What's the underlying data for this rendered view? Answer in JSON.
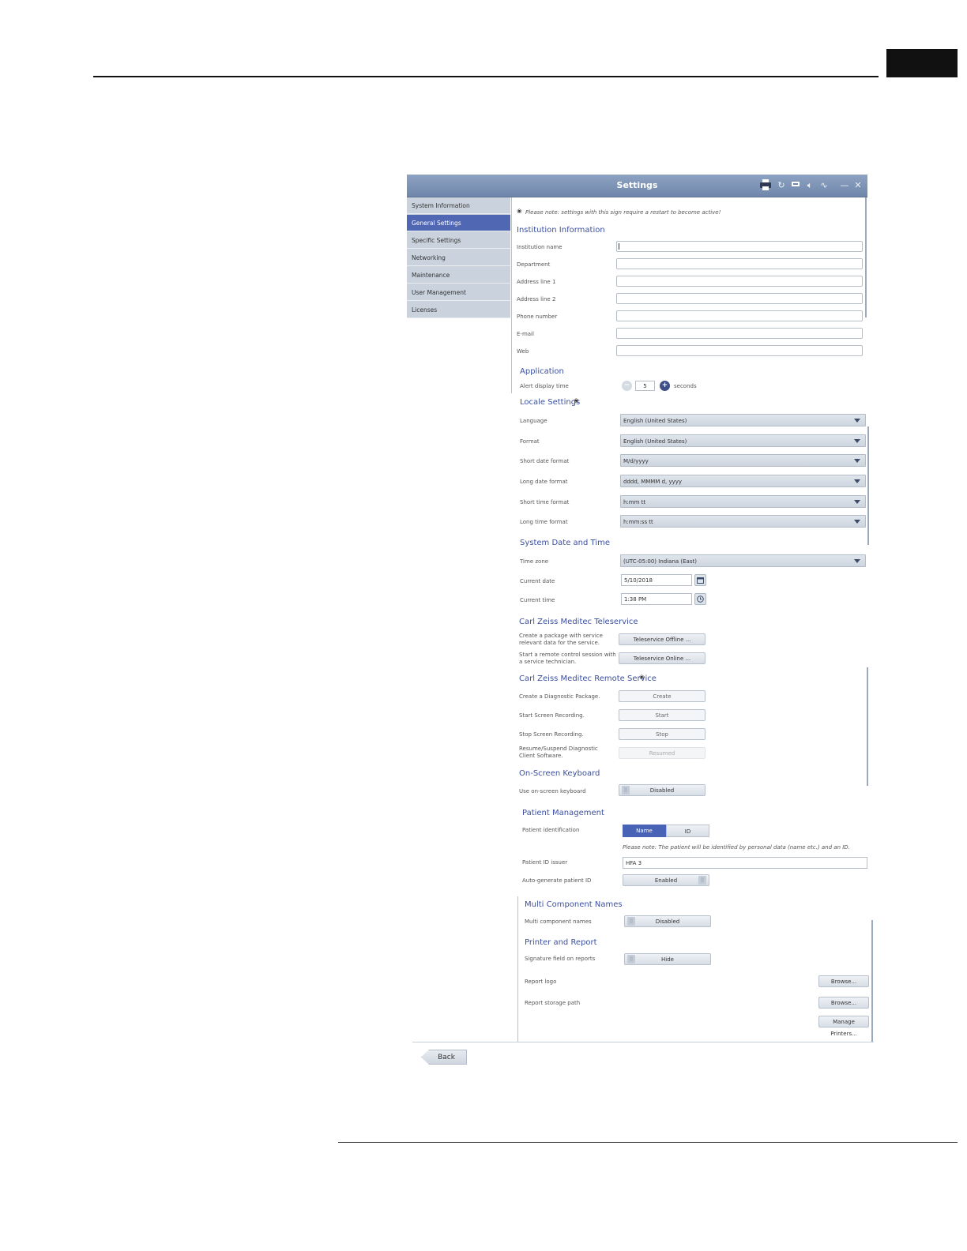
{
  "window": {
    "title": "Settings",
    "icons": [
      "printer-icon",
      "refresh-icon",
      "monitor-icon",
      "speaker-icon",
      "network-icon",
      "minimize-icon",
      "close-icon"
    ]
  },
  "sidebar": {
    "items": [
      {
        "label": "System Information",
        "active": false
      },
      {
        "label": "General Settings",
        "active": true
      },
      {
        "label": "Specific Settings",
        "active": false
      },
      {
        "label": "Networking",
        "active": false
      },
      {
        "label": "Maintenance",
        "active": false
      },
      {
        "label": "User Management",
        "active": false
      },
      {
        "label": "Licenses",
        "active": false
      }
    ]
  },
  "restart_note": "Please note: settings with this sign require a restart to become active!",
  "institution": {
    "heading": "Institution Information",
    "fields": [
      {
        "label": "Institution name",
        "value": ""
      },
      {
        "label": "Department",
        "value": ""
      },
      {
        "label": "Address line 1",
        "value": ""
      },
      {
        "label": "Address line 2",
        "value": ""
      },
      {
        "label": "Phone number",
        "value": ""
      },
      {
        "label": "E-mail",
        "value": ""
      },
      {
        "label": "Web",
        "value": ""
      }
    ]
  },
  "application": {
    "heading": "Application",
    "alert_label": "Alert display time",
    "alert_value": "5",
    "alert_unit": "seconds"
  },
  "locale": {
    "heading": "Locale Settings",
    "rows": [
      {
        "label": "Language",
        "value": "English (United States)"
      },
      {
        "label": "Format",
        "value": "English (United States)"
      },
      {
        "label": "Short date format",
        "value": "M/d/yyyy"
      },
      {
        "label": "Long date format",
        "value": "dddd, MMMM d, yyyy"
      },
      {
        "label": "Short time format",
        "value": "h:mm tt"
      },
      {
        "label": "Long time format",
        "value": "h:mm:ss tt"
      }
    ]
  },
  "datetime": {
    "heading": "System Date and Time",
    "timezone_label": "Time zone",
    "timezone_value": "(UTC-05:00) Indiana (East)",
    "date_label": "Current date",
    "date_value": "5/10/2018",
    "time_label": "Current time",
    "time_value": "1:38 PM"
  },
  "teleservice": {
    "heading": "Carl Zeiss Meditec Teleservice",
    "row1_label": "Create a package with service relevant data for the service.",
    "row1_button": "Teleservice Offline ...",
    "row2_label": "Start a remote control session with a service technician.",
    "row2_button": "Teleservice Online ..."
  },
  "remote_service": {
    "heading": "Carl Zeiss Meditec Remote Service",
    "rows": [
      {
        "label": "Create a Diagnostic Package.",
        "button": "Create"
      },
      {
        "label": "Start Screen Recording.",
        "button": "Start"
      },
      {
        "label": "Stop Screen Recording.",
        "button": "Stop"
      },
      {
        "label": "Resume/Suspend Diagnostic Client Software.",
        "button": "Resumed"
      }
    ]
  },
  "keyboard": {
    "heading": "On-Screen Keyboard",
    "label": "Use on-screen keyboard",
    "value": "Disabled"
  },
  "patient": {
    "heading": "Patient Management",
    "id_label": "Patient identification",
    "seg_name": "Name",
    "seg_id": "ID",
    "note": "Please note: The patient will be identified by personal data (name etc.) and an ID.",
    "issuer_label": "Patient ID issuer",
    "issuer_value": "HFA 3",
    "auto_label": "Auto-generate patient ID",
    "auto_value": "Enabled"
  },
  "multi": {
    "heading": "Multi Component Names",
    "label": "Multi component names",
    "value": "Disabled"
  },
  "printer": {
    "heading": "Printer and Report",
    "signature_label": "Signature field on reports",
    "signature_value": "Hide",
    "logo_label": "Report logo",
    "logo_button": "Browse...",
    "storage_label": "Report storage path",
    "storage_button": "Browse...",
    "manage_button": "Manage Printers..."
  },
  "back_label": "Back"
}
